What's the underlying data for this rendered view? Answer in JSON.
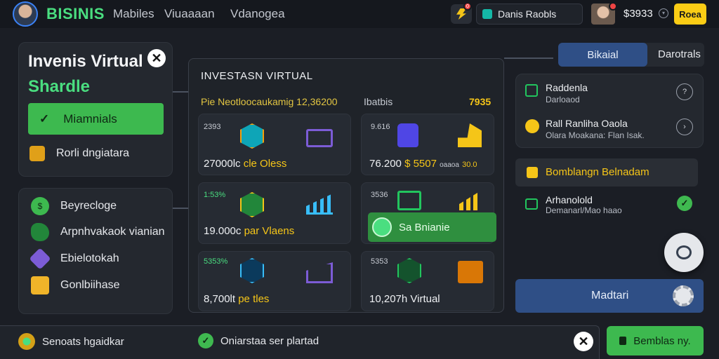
{
  "header": {
    "brand": "BISINIS",
    "nav": [
      "Mabiles",
      "Viuaaaan",
      "Vdanogea"
    ],
    "notification_count": "0",
    "user_chip": "Danis Raobls",
    "balance": "$3933",
    "action_button": "Roea"
  },
  "left_card": {
    "title_line1": "Invenis Virtual",
    "title_line2": "Shardle",
    "primary_button": "Miamnials",
    "secondary_item": "Rorli dngiatara"
  },
  "left_menu": {
    "items": [
      {
        "label": "Beyrecloge",
        "icon": "dollar-coin-icon"
      },
      {
        "label": "Arpnhvakaok vianian",
        "icon": "cloud-icon"
      },
      {
        "label": "Ebielotokah",
        "icon": "cube-icon"
      },
      {
        "label": "Gonlbiihase",
        "icon": "box-icon"
      }
    ]
  },
  "center": {
    "title": "INVESTASN VIRTUAL",
    "header_left": "Pie Neotloocaukamig 12,36200",
    "header_mid": "Ibatbis",
    "header_right": "7935",
    "tiles": [
      {
        "small": "2393",
        "amount": "27000lc",
        "suffix": "cle Oless"
      },
      {
        "small": "9.616",
        "amount": "76.200",
        "suffix": "$ 5507",
        "extra": "oaaoa",
        "extra2": "30.0"
      },
      {
        "small": "1:53%",
        "amount": "19.000c",
        "suffix": "par Vlaens"
      },
      {
        "small": "3536",
        "button": "Sa Bnianie"
      },
      {
        "small": "5353%",
        "amount": "8,700lt",
        "suffix": "pe tles"
      },
      {
        "small": "5353",
        "amount": "10,207h Virtual"
      }
    ]
  },
  "right": {
    "tabs": [
      "Bikaial",
      "Darotrals"
    ],
    "card1": [
      {
        "title": "Raddenla",
        "sub": "Darloaod"
      },
      {
        "title": "Rall Ranliha Oaola",
        "sub": "Olara Moakana: Flan Isak."
      }
    ],
    "alert": "Bomblangn Belnadam",
    "status_item": {
      "title": "Arhanolold",
      "sub": "Demanarl/Mao haao"
    },
    "blue_button": "Madtari"
  },
  "bottom": {
    "item1": "Senoats hgaidkar",
    "item2": "Oniarstaa ser plartad",
    "button": "Bemblas ny."
  },
  "colors": {
    "accent_green": "#3db94f",
    "accent_yellow": "#f5c518",
    "accent_blue": "#2f4f86",
    "background": "#1b1e25"
  }
}
